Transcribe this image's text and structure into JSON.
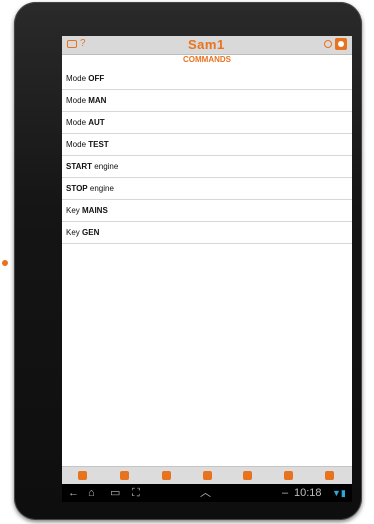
{
  "app": {
    "brand": "Sam1"
  },
  "page": {
    "title": "COMMANDS"
  },
  "commands": [
    {
      "prefix": "Mode ",
      "value": "OFF",
      "bold_prefix": false
    },
    {
      "prefix": "Mode ",
      "value": "MAN",
      "bold_prefix": false
    },
    {
      "prefix": "Mode ",
      "value": "AUT",
      "bold_prefix": false
    },
    {
      "prefix": "Mode ",
      "value": "TEST",
      "bold_prefix": false
    },
    {
      "prefix": "START",
      "value": " engine",
      "bold_prefix": true
    },
    {
      "prefix": "STOP",
      "value": " engine",
      "bold_prefix": true
    },
    {
      "prefix": "Key  ",
      "value": "MAINS",
      "bold_prefix": false
    },
    {
      "prefix": "Key  ",
      "value": "GEN",
      "bold_prefix": false
    }
  ],
  "topbar_icons": [
    "chat-icon",
    "help-icon",
    "status-circle-icon",
    "user-icon"
  ],
  "bottom_nav_icons": [
    "home-icon",
    "nav-icon-2",
    "nav-icon-3",
    "nav-icon-4",
    "nav-icon-5",
    "nav-icon-6",
    "nav-icon-7"
  ],
  "system_bar": {
    "back": "←",
    "home": "⌂",
    "recents": "▭",
    "screenshot": "⛶",
    "up": "︿",
    "clock": "10:18",
    "dash": "–",
    "status": "▼▮"
  },
  "colors": {
    "accent": "#e8731f",
    "bezel": "#151515",
    "status_blue": "#2fa5d8"
  }
}
